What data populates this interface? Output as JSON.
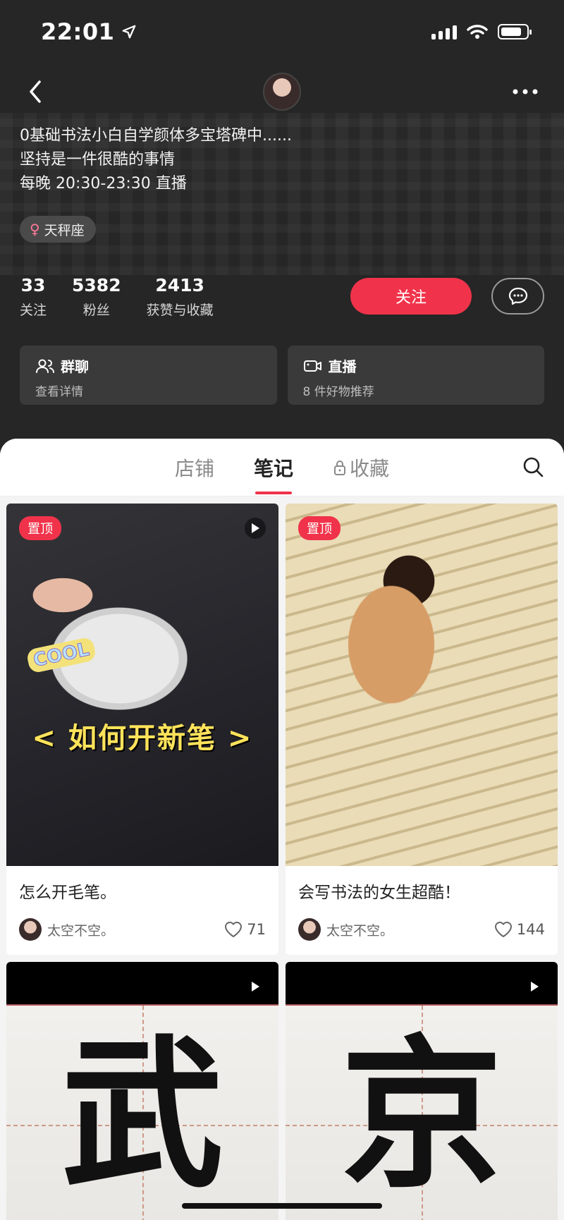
{
  "status": {
    "time": "22:01"
  },
  "profile": {
    "bio_lines": [
      "0基础书法小白自学颜体多宝塔碑中......",
      "坚持是一件很酷的事情",
      "每晚 20:30-23:30 直播"
    ],
    "tag": "天秤座",
    "stats": [
      {
        "num": "33",
        "label": "关注"
      },
      {
        "num": "5382",
        "label": "粉丝"
      },
      {
        "num": "2413",
        "label": "获赞与收藏"
      }
    ],
    "follow_label": "关注"
  },
  "cards": [
    {
      "title": "群聊",
      "sub": "查看详情",
      "icon": "group-icon"
    },
    {
      "title": "直播",
      "sub": "8 件好物推荐",
      "icon": "live-camera-icon"
    }
  ],
  "tabs": [
    {
      "label": "店铺",
      "active": false
    },
    {
      "label": "笔记",
      "active": true
    },
    {
      "label": "收藏",
      "active": false,
      "locked": true
    }
  ],
  "notes": [
    {
      "pinned_label": "置顶",
      "overlay": "< 如何开新笔 >",
      "sticker": "COOL",
      "title": "怎么开毛笔。",
      "author": "太空不空。",
      "likes": "71"
    },
    {
      "pinned_label": "置顶",
      "title": "会写书法的女生超酷！",
      "author": "太空不空。",
      "likes": "144"
    },
    {
      "glyph": "武"
    },
    {
      "glyph": "京"
    }
  ],
  "colors": {
    "accent": "#f0334a",
    "dark_bg": "#262626",
    "panel_bg": "#f4f4f4"
  }
}
